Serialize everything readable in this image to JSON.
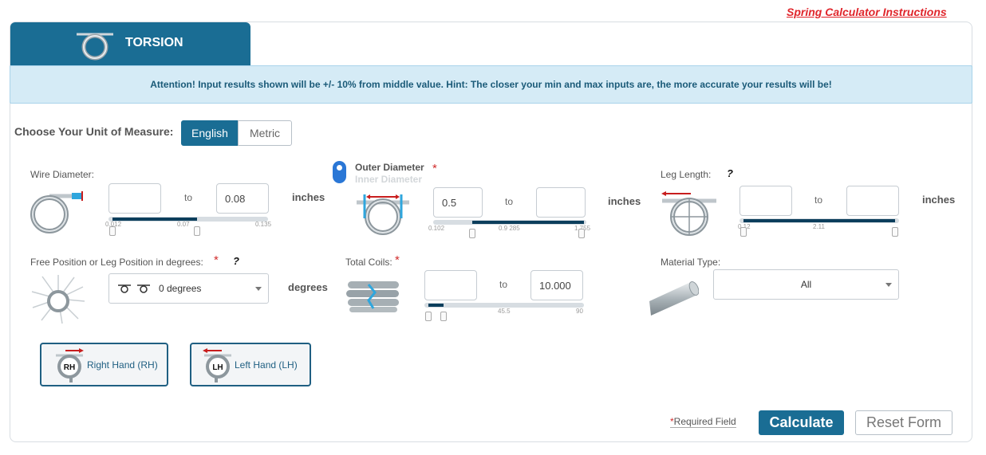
{
  "header": {
    "instructions_link": "Spring Calculator Instructions"
  },
  "tab": {
    "label": "TORSION"
  },
  "attention": {
    "text": "Attention! Input results shown will be +/- 10% from middle value. Hint: The closer your min and max inputs are, the more accurate your results will be!"
  },
  "unit_of_measure": {
    "label": "Choose Your Unit of Measure:",
    "options": [
      "English",
      "Metric"
    ],
    "selected": "English"
  },
  "wire_diameter": {
    "label": "Wire Diameter:",
    "min_value": "",
    "max_value": "0.08",
    "to": "to",
    "unit": "inches",
    "slider": {
      "labels": [
        "0.012",
        "0.07",
        "0.135"
      ]
    }
  },
  "diameter": {
    "outer_label": "Outer Diameter",
    "inner_label": "Inner Diameter",
    "required": "*",
    "min_value": "0.5",
    "max_value": "",
    "to": "to",
    "unit": "inches",
    "slider": {
      "labels": [
        "0.102",
        "0.9 285",
        "1.755"
      ]
    }
  },
  "leg_length": {
    "label": "Leg Length:",
    "help": "?",
    "min_value": "",
    "max_value": "",
    "to": "to",
    "unit": "inches",
    "slider": {
      "labels": [
        "0.12",
        "2.11"
      ]
    }
  },
  "free_position": {
    "label": "Free Position or Leg Position in degrees:",
    "required": "*",
    "help": "?",
    "selected": "0 degrees",
    "unit": "degrees"
  },
  "total_coils": {
    "label": "Total Coils:",
    "required": "*",
    "min_value": "",
    "max_value": "10.000",
    "to": "to",
    "slider": {
      "labels": [
        "45.5",
        "90"
      ]
    }
  },
  "material_type": {
    "label": "Material Type:",
    "selected": "All"
  },
  "hand": {
    "right": {
      "badge": "RH",
      "label": "Right Hand (RH)"
    },
    "left": {
      "badge": "LH",
      "label": "Left Hand (LH)"
    }
  },
  "footer": {
    "required_star": "*",
    "required_text": "Required Field",
    "calculate": "Calculate",
    "reset": "Reset Form"
  },
  "colors": {
    "primary": "#1a6d94",
    "slider_fill": "#0c3e5c",
    "required": "#d12c2c",
    "attention_bg": "#d5ebf6"
  }
}
